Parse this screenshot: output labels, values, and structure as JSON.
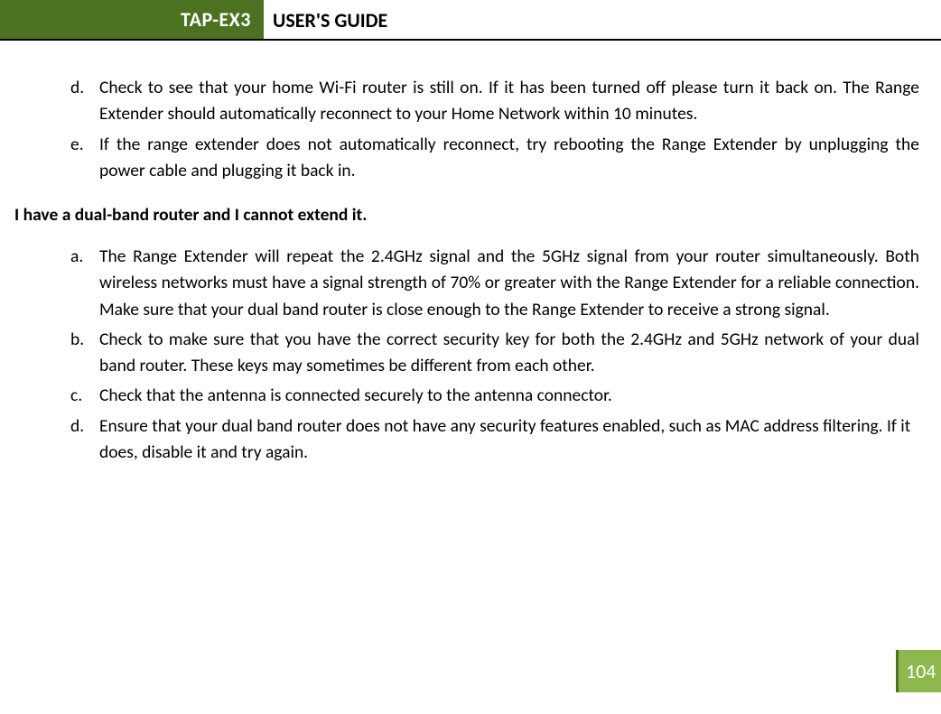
{
  "header": {
    "badge": "TAP-EX3",
    "title": "USER'S GUIDE"
  },
  "list1": [
    {
      "marker": "d.",
      "text": "Check to see that your home Wi-Fi router is still on. If it has been turned off please turn it back on. The Range Extender should automatically reconnect to your Home Network within 10 minutes."
    },
    {
      "marker": "e.",
      "text": "If the range extender does not automatically reconnect, try rebooting the Range Extender by unplugging the power cable and plugging it back in."
    }
  ],
  "heading": "I have a dual-band router and I cannot extend it.",
  "list2": [
    {
      "marker": "a.",
      "text": "The Range Extender will repeat the 2.4GHz signal and the 5GHz signal from your router simultaneously. Both wireless networks must have a signal strength of 70% or greater with the Range Extender for a reliable connection. Make sure that your dual band router is close enough to the Range Extender to receive a strong signal."
    },
    {
      "marker": "b.",
      "text": "Check to make sure that you have the correct security key for both the 2.4GHz and 5GHz network of your dual band router. These keys may sometimes be different from each other."
    },
    {
      "marker": "c.",
      "text": "Check that the antenna is connected securely to the antenna connector."
    },
    {
      "marker": "d.",
      "text": "Ensure that your dual band router does not have any security features enabled, such as MAC address filtering. If it does, disable it and try again."
    }
  ],
  "page_number": "104"
}
